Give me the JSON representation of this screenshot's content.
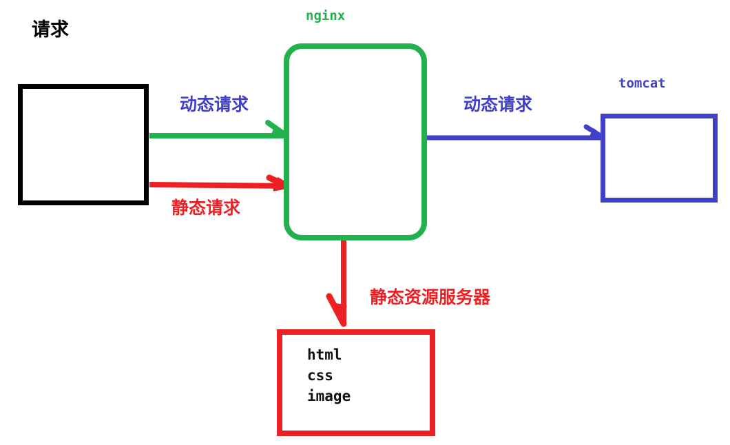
{
  "diagram": {
    "title": "nginx static/dynamic request routing diagram",
    "background": "#ffffff",
    "colors": {
      "black": "#000000",
      "green": "#22B14C",
      "blue": "#4040C8",
      "red": "#ED2024"
    },
    "nodes": {
      "client": {
        "label": "请求",
        "border_color": "#000000",
        "contents": ""
      },
      "nginx": {
        "label": "nginx",
        "border_color": "#22B14C",
        "contents": ""
      },
      "tomcat": {
        "label": "tomcat",
        "border_color": "#4040C8",
        "contents": ""
      },
      "static_server": {
        "label": "静态资源服务器",
        "border_color": "#ED2024",
        "lines": [
          "html",
          "css",
          "image"
        ]
      }
    },
    "edges": [
      {
        "name": "client-to-nginx-dynamic",
        "label": "动态请求",
        "line_color": "#22B14C",
        "label_color": "#4040C8",
        "from": "请求",
        "to": "nginx"
      },
      {
        "name": "client-to-nginx-static",
        "label": "静态请求",
        "line_color": "#ED2024",
        "label_color": "#ED2024",
        "from": "请求",
        "to": "nginx"
      },
      {
        "name": "nginx-to-tomcat-dynamic",
        "label": "动态请求",
        "line_color": "#4040C8",
        "label_color": "#4040C8",
        "from": "nginx",
        "to": "tomcat"
      },
      {
        "name": "nginx-to-static-server",
        "label": "静态资源服务器",
        "line_color": "#ED2024",
        "label_color": "#ED2024",
        "from": "nginx",
        "to": "静态资源服务器"
      }
    ]
  }
}
